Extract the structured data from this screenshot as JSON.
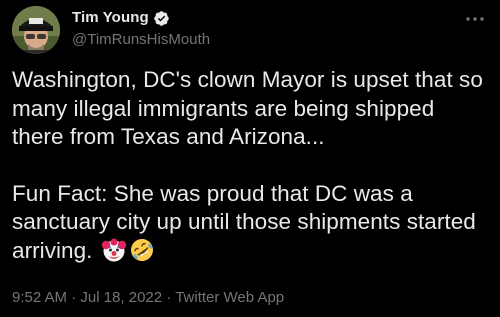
{
  "author": {
    "display_name": "Tim Young",
    "handle": "@TimRunsHisMouth",
    "verified": true
  },
  "tweet": {
    "paragraphs": [
      "Washington, DC's clown Mayor is upset that so many illegal immigrants are being shipped there from Texas and Arizona...",
      "Fun Fact:  She was proud that DC was a sanctuary city up until those shipments started arriving."
    ],
    "emojis": [
      "clown-face-emoji",
      "rolling-on-floor-laughing-emoji"
    ]
  },
  "meta": {
    "time": "9:52 AM",
    "separator": " · ",
    "date": "Jul 18, 2022",
    "source": "Twitter Web App"
  },
  "colors": {
    "background": "#000000",
    "text_primary": "#e7e9ea",
    "text_secondary": "#71767b",
    "verified_badge": "#1d9bf0"
  }
}
